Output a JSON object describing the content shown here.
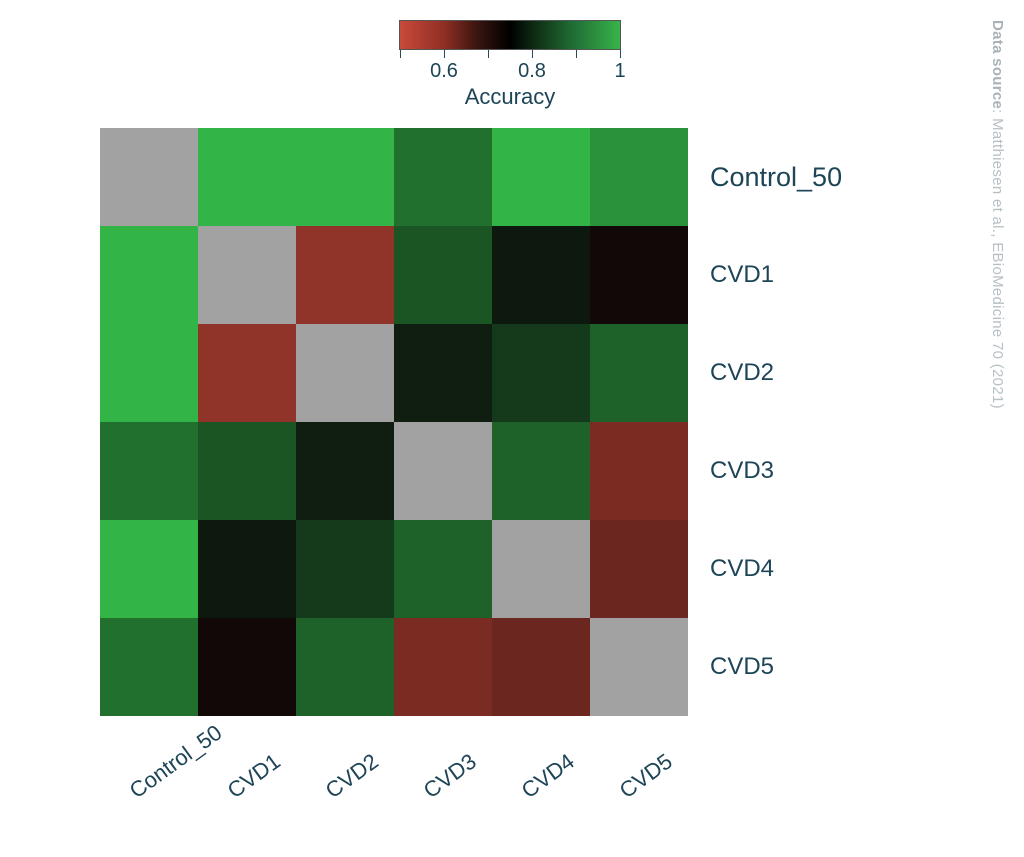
{
  "source": {
    "prefix": "Data source",
    "text": ": Matthiesen et al., EBioMedicine 70 (2021)"
  },
  "chart_data": {
    "type": "heatmap",
    "title": "",
    "colorbar_label": "Accuracy",
    "categories": [
      "Control_50",
      "CVD1",
      "CVD2",
      "CVD3",
      "CVD4",
      "CVD5"
    ],
    "colorbar_ticks": [
      0.6,
      0.8,
      1
    ],
    "colorbar_range": [
      0.5,
      1.0
    ],
    "diagonal": null,
    "matrix": [
      [
        null,
        1.0,
        1.0,
        0.9,
        1.0,
        0.95
      ],
      [
        1.0,
        null,
        0.57,
        0.86,
        0.77,
        0.74
      ],
      [
        1.0,
        0.57,
        null,
        0.78,
        0.82,
        0.88
      ],
      [
        0.9,
        0.86,
        0.78,
        null,
        0.88,
        0.6
      ],
      [
        1.0,
        0.77,
        0.82,
        0.88,
        null,
        0.62
      ],
      [
        0.9,
        0.74,
        0.88,
        0.6,
        0.62,
        null
      ]
    ],
    "xlabel": "",
    "ylabel": ""
  }
}
